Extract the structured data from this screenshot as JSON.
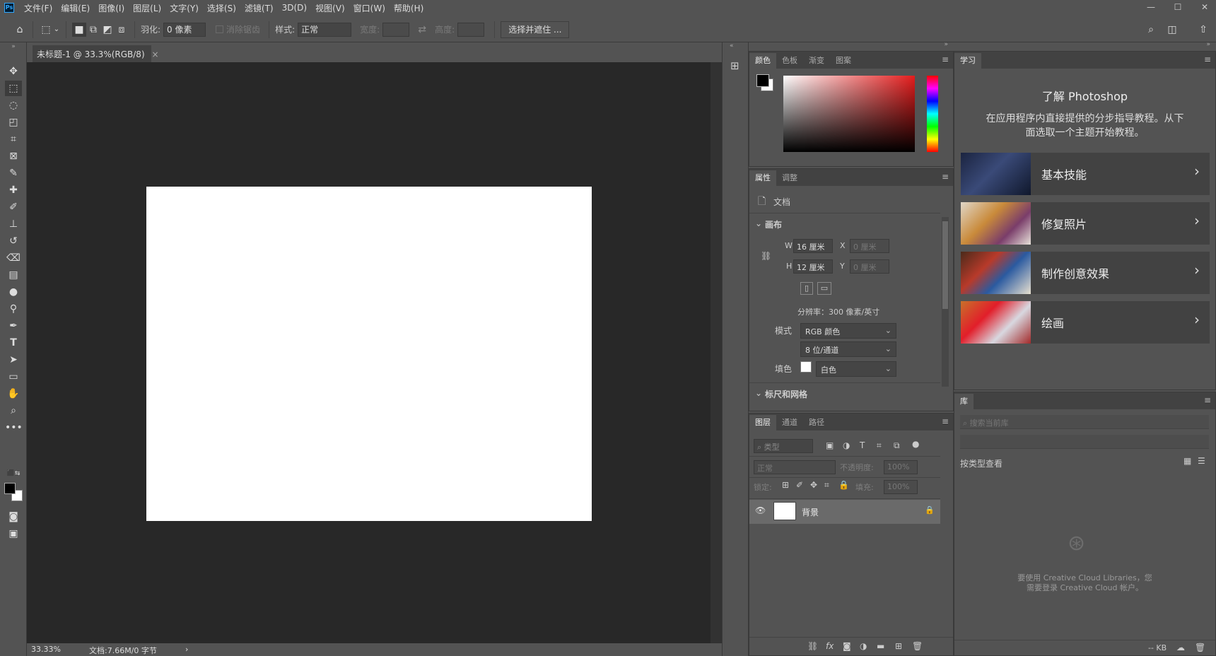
{
  "app": {
    "logo": "Ps"
  },
  "menu": [
    "文件(F)",
    "编辑(E)",
    "图像(I)",
    "图层(L)",
    "文字(Y)",
    "选择(S)",
    "滤镜(T)",
    "3D(D)",
    "视图(V)",
    "窗口(W)",
    "帮助(H)"
  ],
  "window_controls": {
    "minimize": "—",
    "maximize": "☐",
    "close": "✕"
  },
  "options": {
    "feather_label": "羽化:",
    "feather_value": "0 像素",
    "antialias_label": "消除锯齿",
    "style_label": "样式:",
    "style_value": "正常",
    "width_label": "宽度:",
    "height_label": "高度:",
    "select_mask_button": "选择并遮住 ..."
  },
  "document_tab": {
    "title": "未标题-1 @ 33.3%(RGB/8)",
    "close": "×"
  },
  "status": {
    "zoom": "33.33%",
    "doc_info": "文档:7.66M/0 字节",
    "arrow": "›"
  },
  "color_panel": {
    "tabs": [
      "颜色",
      "色板",
      "渐变",
      "图案"
    ],
    "hue_color": "#e41d1d",
    "foreground": "#000000",
    "background": "#ffffff"
  },
  "properties_panel": {
    "tabs": [
      "属性",
      "调整"
    ],
    "doc_label": "文档",
    "section_canvas": "画布",
    "w_label": "W",
    "w_value": "16 厘米",
    "h_label": "H",
    "h_value": "12 厘米",
    "x_label": "X",
    "x_value": "0 厘米",
    "y_label": "Y",
    "y_value": "0 厘米",
    "resolution": "分辨率：300 像素/英寸",
    "mode_label": "模式",
    "mode_value": "RGB 颜色",
    "depth_value": "8 位/通道",
    "fill_label": "填色",
    "fill_value": "白色",
    "next_section": "标尺和网格"
  },
  "layers_panel": {
    "tabs": [
      "图层",
      "通道",
      "路径"
    ],
    "filter_placeholder": "类型",
    "blend_mode": "正常",
    "opacity_label": "不透明度:",
    "opacity_value": "100%",
    "lock_label": "锁定:",
    "fill_label": "填充:",
    "fill_value": "100%",
    "layers": [
      {
        "name": "背景",
        "visible": true,
        "locked": true
      }
    ]
  },
  "learn_panel": {
    "tab": "学习",
    "title": "了解 Photoshop",
    "desc_line1": "在应用程序内直接提供的分步指导教程。从下",
    "desc_line2": "面选取一个主题开始教程。",
    "cards": [
      {
        "title": "基本技能"
      },
      {
        "title": "修复照片"
      },
      {
        "title": "制作创意效果"
      },
      {
        "title": "绘画"
      }
    ]
  },
  "library_panel": {
    "tab": "库",
    "search_placeholder": "搜索当前库",
    "view_by": "按类型查看",
    "message_line1": "要使用 Creative Cloud Libraries，您",
    "message_line2": "需要登录 Creative Cloud 帐户。",
    "size": "-- KB"
  }
}
